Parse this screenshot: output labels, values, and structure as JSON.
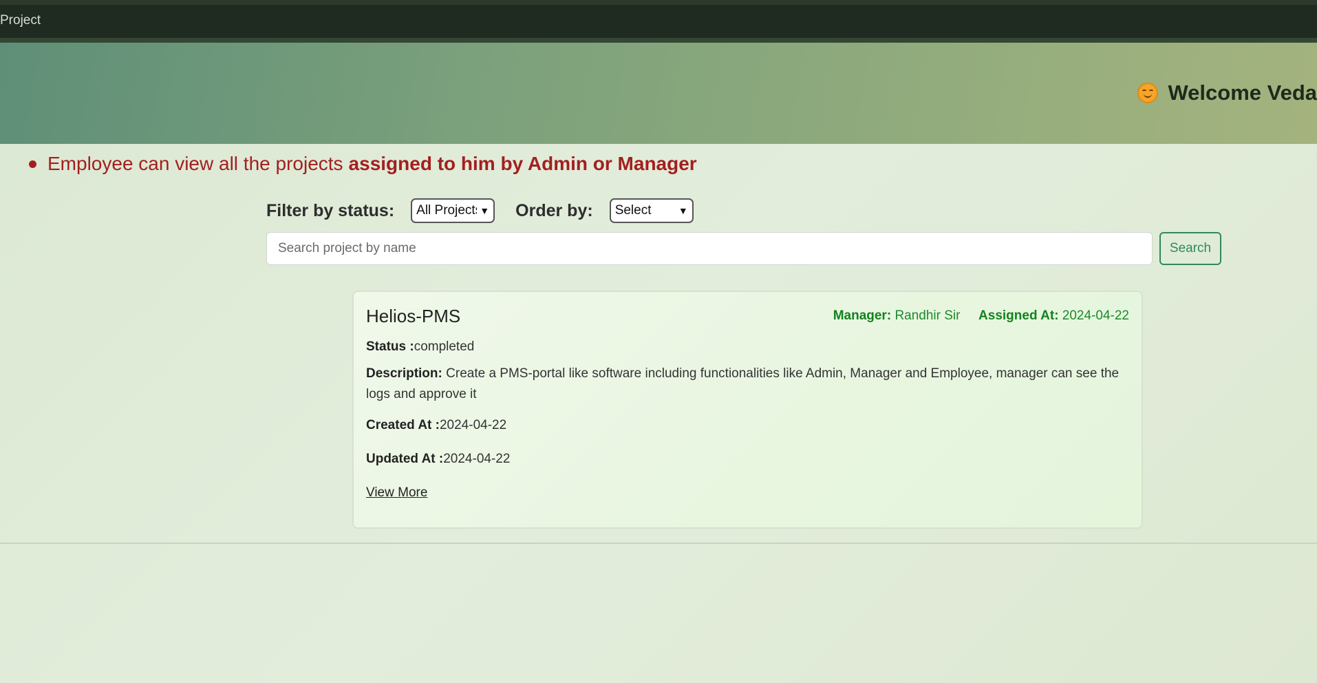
{
  "nav": {
    "item": "Project"
  },
  "hero": {
    "welcome": "Welcome Veda"
  },
  "info": {
    "text": "Employee can view all the projects",
    "bold": "assigned to him by Admin or Manager"
  },
  "filters": {
    "status_label": "Filter by status:",
    "status_value": "All Projects",
    "order_label": "Order by:",
    "order_value": "Select"
  },
  "search": {
    "placeholder": "Search project by name",
    "button": "Search"
  },
  "project": {
    "name": "Helios-PMS",
    "manager_label": "Manager:",
    "manager": "Randhir Sir",
    "assigned_label": "Assigned At:",
    "assigned_at": "2024-04-22",
    "status_label": "Status :",
    "status": "completed",
    "description_label": "Description:",
    "description": "Create a PMS-portal like software including functionalities like Admin, Manager and Employee, manager can see the logs and approve it",
    "created_label": "Created At :",
    "created_at": "2024-04-22",
    "updated_label": "Updated At :",
    "updated_at": "2024-04-22",
    "view_more": "View More"
  },
  "colors": {
    "nav_bg": "#1f2b20",
    "alert_text": "#a31f1f",
    "accent_green": "#2f8a5a",
    "meta_green": "#13821f"
  }
}
